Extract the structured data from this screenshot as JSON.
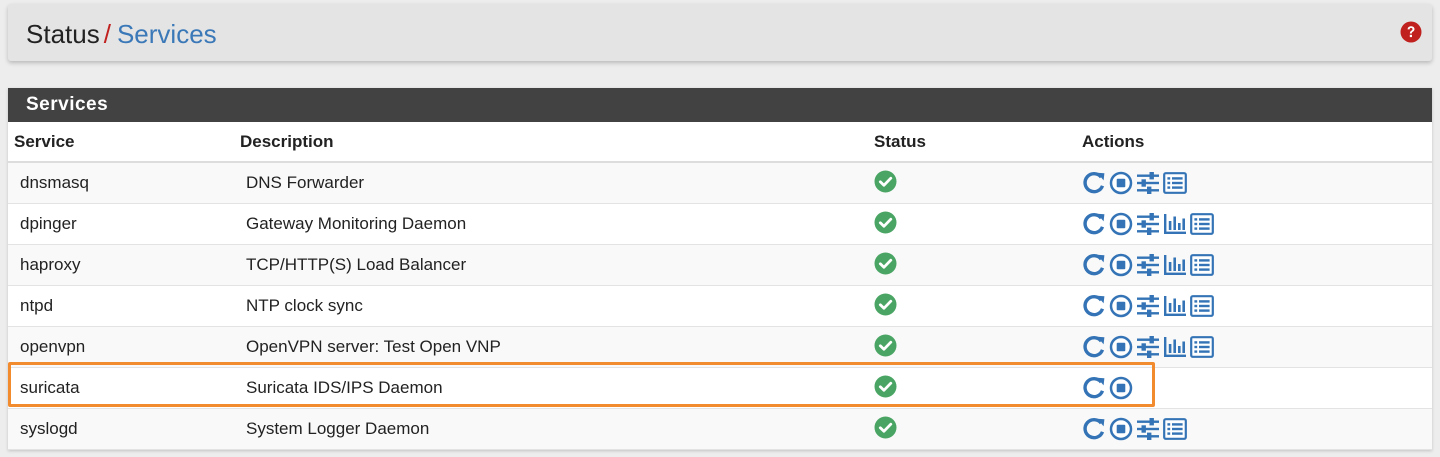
{
  "breadcrumb": {
    "parent": "Status",
    "separator": "/",
    "current": "Services"
  },
  "panel": {
    "title": "Services"
  },
  "table": {
    "headers": {
      "service": "Service",
      "description": "Description",
      "status": "Status",
      "actions": "Actions"
    },
    "rows": [
      {
        "service": "dnsmasq",
        "description": "DNS Forwarder",
        "actions": [
          "restart",
          "stop",
          "settings",
          "logs"
        ]
      },
      {
        "service": "dpinger",
        "description": "Gateway Monitoring Daemon",
        "actions": [
          "restart",
          "stop",
          "settings",
          "graph",
          "logs"
        ]
      },
      {
        "service": "haproxy",
        "description": "TCP/HTTP(S) Load Balancer",
        "actions": [
          "restart",
          "stop",
          "settings",
          "graph",
          "logs"
        ]
      },
      {
        "service": "ntpd",
        "description": "NTP clock sync",
        "actions": [
          "restart",
          "stop",
          "settings",
          "graph",
          "logs"
        ]
      },
      {
        "service": "openvpn",
        "description": "OpenVPN server: Test Open VNP",
        "actions": [
          "restart",
          "stop",
          "settings",
          "graph",
          "logs"
        ]
      },
      {
        "service": "suricata",
        "description": "Suricata IDS/IPS Daemon",
        "actions": [
          "restart",
          "stop"
        ],
        "highlighted": true
      },
      {
        "service": "syslogd",
        "description": "System Logger Daemon",
        "actions": [
          "restart",
          "stop",
          "settings",
          "logs"
        ]
      }
    ]
  },
  "icons": {
    "help": "help-circle-icon",
    "status_running": "check-circle-icon",
    "restart": "restart-icon",
    "stop": "stop-circle-icon",
    "settings": "sliders-icon",
    "graph": "bar-chart-icon",
    "logs": "list-icon"
  },
  "colors": {
    "link": "#3a78b8",
    "action_icon": "#3474b6",
    "status_ok": "#4aa564",
    "help": "#c0211f",
    "panel_heading": "#424242",
    "highlight": "#f28a2e"
  }
}
